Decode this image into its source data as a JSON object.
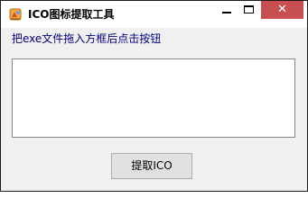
{
  "window": {
    "title": "ICO图标提取工具",
    "app_icon": "tools-icon",
    "controls": {
      "minimize_icon": "minimize-icon",
      "maximize_icon": "maximize-icon",
      "close_icon": "close-icon",
      "close_glyph": "✕",
      "close_color": "#c74f50"
    }
  },
  "main": {
    "hint_text": "把exe文件拖入方框后点击按钮",
    "hint_color": "#000080",
    "drop_box_value": "",
    "action_button_label": "提取ICO"
  }
}
